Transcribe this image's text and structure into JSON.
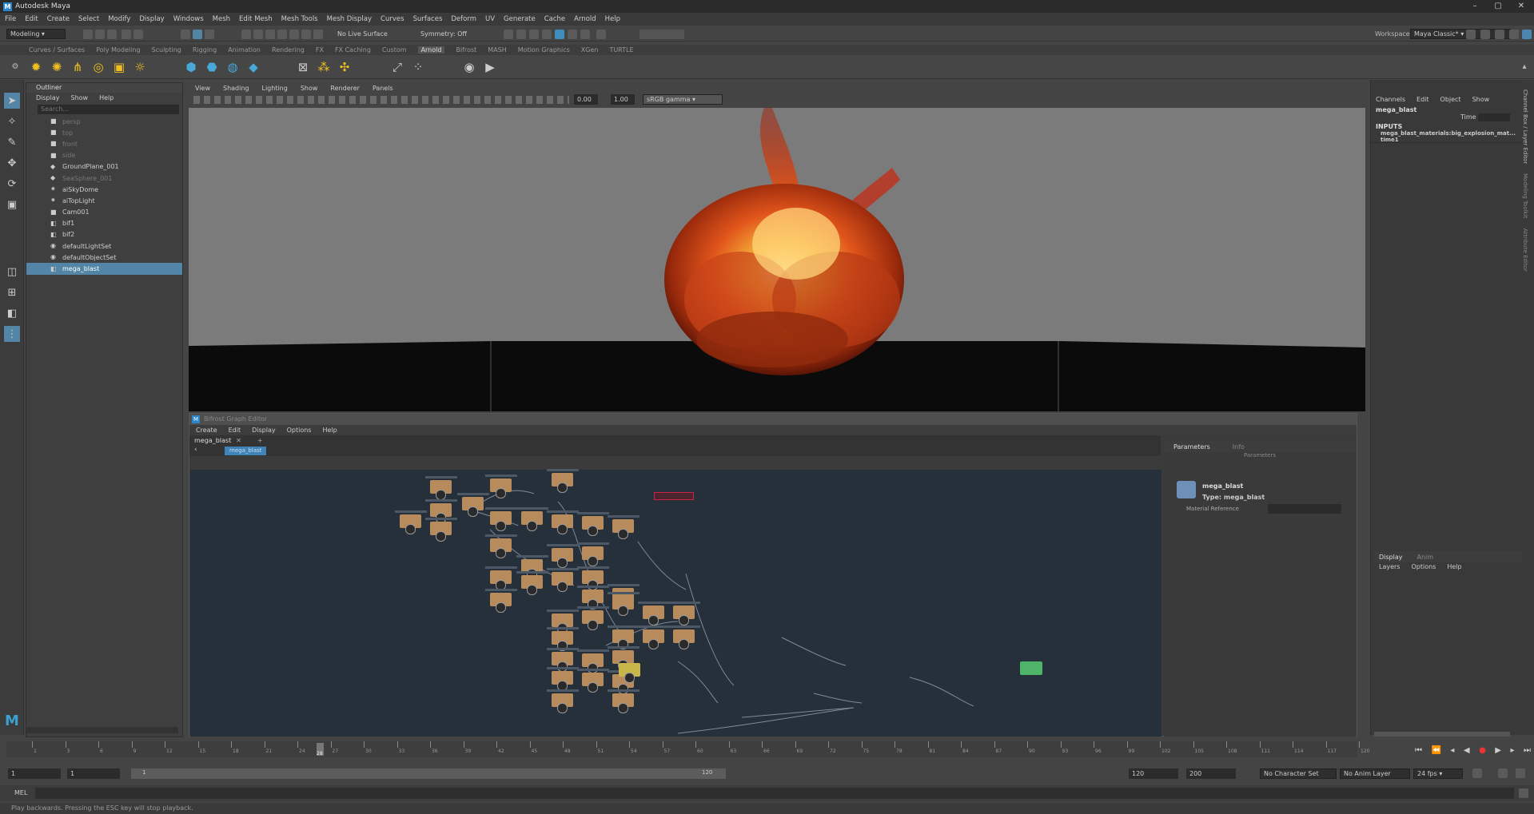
{
  "window": {
    "title": "Autodesk Maya",
    "controls": [
      "–",
      "▢",
      "✕"
    ]
  },
  "menubar": [
    "File",
    "Edit",
    "Create",
    "Select",
    "Modify",
    "Display",
    "Windows",
    "Mesh",
    "Edit Mesh",
    "Mesh Tools",
    "Mesh Display",
    "Curves",
    "Surfaces",
    "Deform",
    "UV",
    "Generate",
    "Cache",
    "Arnold",
    "Help"
  ],
  "statusline": {
    "mode": "Modeling",
    "live_surface": "No Live Surface",
    "symmetry": "Symmetry: Off",
    "workspace_label": "Workspace :",
    "workspace_value": "Maya Classic*"
  },
  "shelf_tabs": [
    "Curves / Surfaces",
    "Poly Modeling",
    "Sculpting",
    "Rigging",
    "Animation",
    "Rendering",
    "FX",
    "FX Caching",
    "Custom",
    "Arnold",
    "Bifrost",
    "MASH",
    "Motion Graphics",
    "XGen",
    "TURTLE"
  ],
  "shelf_active_tab": "Arnold",
  "outliner": {
    "title": "Outliner",
    "menu": [
      "Display",
      "Show",
      "Help"
    ],
    "search_placeholder": "Search...",
    "items": [
      {
        "label": "persp",
        "icon": "camera-icon",
        "state": "dim"
      },
      {
        "label": "top",
        "icon": "camera-icon",
        "state": "dim"
      },
      {
        "label": "front",
        "icon": "camera-icon",
        "state": "dim"
      },
      {
        "label": "side",
        "icon": "camera-icon",
        "state": "dim"
      },
      {
        "label": "GroundPlane_001",
        "icon": "mesh-icon",
        "state": "normal"
      },
      {
        "label": "SeaSphere_001",
        "icon": "mesh-icon",
        "state": "dim"
      },
      {
        "label": "aiSkyDome",
        "icon": "light-icon",
        "state": "normal"
      },
      {
        "label": "aiTopLight",
        "icon": "light-icon",
        "state": "normal"
      },
      {
        "label": "Cam001",
        "icon": "camera-icon",
        "state": "normal"
      },
      {
        "label": "bif1",
        "icon": "node-icon",
        "state": "normal"
      },
      {
        "label": "bif2",
        "icon": "node-icon",
        "state": "normal"
      },
      {
        "label": "defaultLightSet",
        "icon": "set-icon",
        "state": "normal"
      },
      {
        "label": "defaultObjectSet",
        "icon": "set-icon",
        "state": "normal"
      },
      {
        "label": "mega_blast",
        "icon": "node-icon",
        "state": "selected"
      }
    ]
  },
  "viewport": {
    "menu": [
      "View",
      "Shading",
      "Lighting",
      "Show",
      "Renderer",
      "Panels"
    ],
    "exposure": "0.00",
    "gamma": "1.00",
    "color_space": "sRGB gamma"
  },
  "graph_editor": {
    "title": "Bifrost Graph Editor",
    "menu": [
      "Create",
      "Edit",
      "Display",
      "Options",
      "Help"
    ],
    "tab": "mega_blast",
    "breadcrumb": "mega_blast",
    "params_tabs": [
      "Parameters",
      "Info"
    ],
    "params_header": "Parameters",
    "node_name": "mega_blast",
    "node_type": "Type: mega_blast",
    "material_label": "Material Reference"
  },
  "channel_box": {
    "menu": [
      "Channels",
      "Edit",
      "Object",
      "Show"
    ],
    "node": "mega_blast",
    "time_label": "Time",
    "inputs_label": "INPUTS",
    "input_1": "mega_blast_materials:big_explosion_mat...",
    "input_2": "time1",
    "side_tabs": [
      "Channel Box / Layer Editor",
      "Modeling Toolkit",
      "Attribute Editor"
    ],
    "layer_tabs": [
      "Display",
      "Anim"
    ],
    "layer_menu": [
      "Layers",
      "Options",
      "Help"
    ]
  },
  "timeline": {
    "ticks": [
      "1",
      "3",
      "6",
      "9",
      "12",
      "15",
      "18",
      "21",
      "24",
      "27",
      "30",
      "33",
      "36",
      "39",
      "42",
      "45",
      "48",
      "51",
      "54",
      "57",
      "60",
      "63",
      "66",
      "69",
      "72",
      "75",
      "78",
      "81",
      "84",
      "87",
      "90",
      "93",
      "96",
      "99",
      "102",
      "105",
      "108",
      "111",
      "114",
      "117",
      "120"
    ],
    "current_frame": "28"
  },
  "range": {
    "start": "1",
    "anim_start": "1",
    "range_start_label": "1",
    "range_end_label": "120",
    "playback_end": "120",
    "anim_end": "200",
    "character_set": "No Character Set",
    "anim_layer": "No Anim Layer",
    "fps": "24 fps"
  },
  "cmdline": {
    "label": "MEL"
  },
  "helpline": "Play backwards. Pressing the ESC key will stop playback.",
  "colors": {
    "selection": "#5285a6",
    "node": "#b88b5c",
    "output_node": "#4fb36a",
    "graph_bg": "#26303b",
    "maya_logo": "#2a86c8"
  }
}
